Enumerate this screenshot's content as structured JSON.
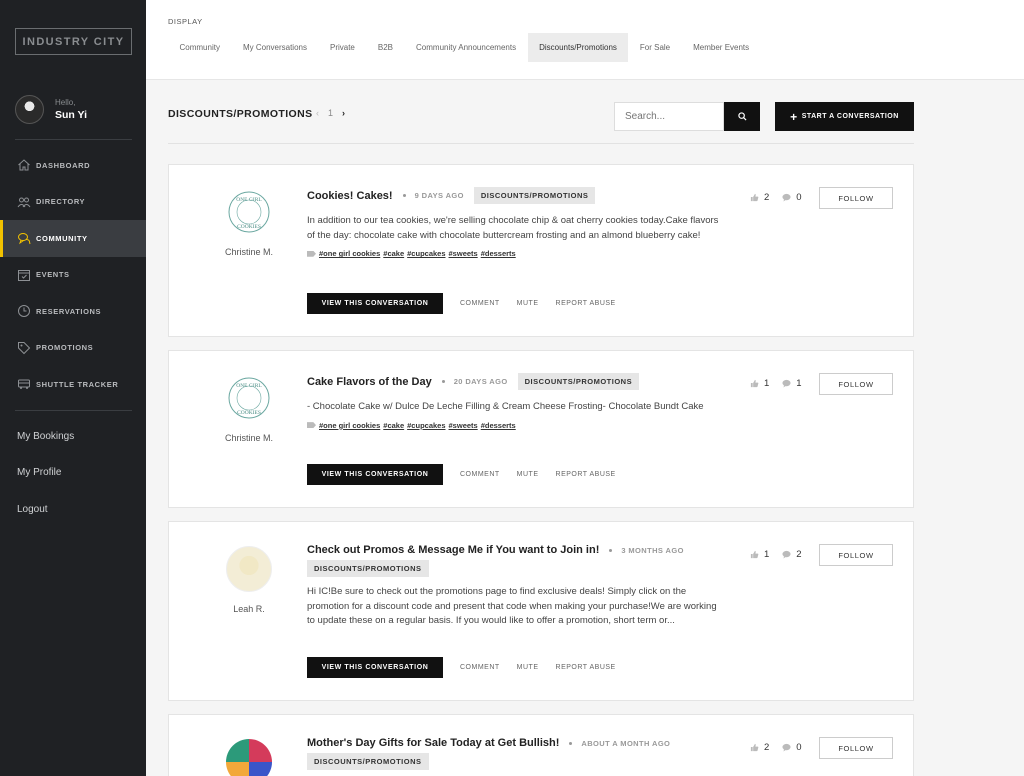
{
  "sidebar": {
    "logo": "INDUSTRY CITY",
    "hello": "Hello,",
    "user_name": "Sun Yi",
    "nav": [
      {
        "label": "DASHBOARD",
        "icon": "home-icon"
      },
      {
        "label": "DIRECTORY",
        "icon": "people-icon"
      },
      {
        "label": "COMMUNITY",
        "icon": "chat-icon",
        "active": true
      },
      {
        "label": "EVENTS",
        "icon": "calendar-icon"
      },
      {
        "label": "RESERVATIONS",
        "icon": "clock-icon"
      },
      {
        "label": "PROMOTIONS",
        "icon": "tag-icon"
      },
      {
        "label": "SHUTTLE TRACKER",
        "icon": "bus-icon"
      }
    ],
    "links": [
      "My Bookings",
      "My Profile",
      "Logout"
    ]
  },
  "topbar": {
    "label": "DISPLAY",
    "tabs": [
      "Community",
      "My Conversations",
      "Private",
      "B2B",
      "Community Announcements",
      "Discounts/Promotions",
      "For Sale",
      "Member Events"
    ],
    "active_tab": "Discounts/Promotions"
  },
  "header": {
    "title": "DISCOUNTS/PROMOTIONS",
    "prev": "‹",
    "page": "1",
    "next": "›",
    "search_placeholder": "Search...",
    "start_label": "START A CONVERSATION"
  },
  "posts": [
    {
      "author": "Christine M.",
      "title": "Cookies! Cakes!",
      "age": "9 DAYS AGO",
      "category": "DISCOUNTS/PROMOTIONS",
      "text": "In addition to our tea cookies, we're selling chocolate chip & oat cherry cookies today.Cake flavors of the day: chocolate cake with chocolate buttercream frosting and an almond blueberry cake!",
      "tags": [
        "#one girl cookies",
        "#cake",
        "#cupcakes",
        "#sweets",
        "#desserts"
      ],
      "likes": "2",
      "comments": "0"
    },
    {
      "author": "Christine M.",
      "title": "Cake Flavors of the Day",
      "age": "20 DAYS AGO",
      "category": "DISCOUNTS/PROMOTIONS",
      "text": "- Chocolate Cake w/ Dulce De Leche Filling & Cream Cheese Frosting- Chocolate Bundt Cake",
      "tags": [
        "#one girl cookies",
        "#cake",
        "#cupcakes",
        "#sweets",
        "#desserts"
      ],
      "likes": "1",
      "comments": "1"
    },
    {
      "author": "Leah R.",
      "title": "Check out Promos & Message Me if You want to Join in!",
      "age": "3 MONTHS AGO",
      "category": "DISCOUNTS/PROMOTIONS",
      "text": "Hi IC!Be sure to check out the promotions page to find exclusive deals! Simply click on the promotion for a discount code and present that code when making your purchase!We are working to update these on a regular basis. If you would like to offer a promotion, short term or...",
      "tags": [],
      "likes": "1",
      "comments": "2"
    },
    {
      "author": "",
      "title": "Mother's Day Gifts for Sale Today at Get Bullish!",
      "age": "ABOUT A MONTH AGO",
      "category": "DISCOUNTS/PROMOTIONS",
      "text": "",
      "tags": [],
      "likes": "2",
      "comments": "0"
    }
  ],
  "post_actions": {
    "view": "VIEW THIS CONVERSATION",
    "comment": "COMMENT",
    "mute": "MUTE",
    "report": "REPORT ABUSE",
    "follow": "FOLLOW"
  },
  "logo_text": {
    "top": "ONE GIRL",
    "bottom": "COOKIES"
  },
  "colors": {
    "sidebar_bg": "#1f2124",
    "accent": "#f2c200",
    "button_bg": "#111111"
  }
}
